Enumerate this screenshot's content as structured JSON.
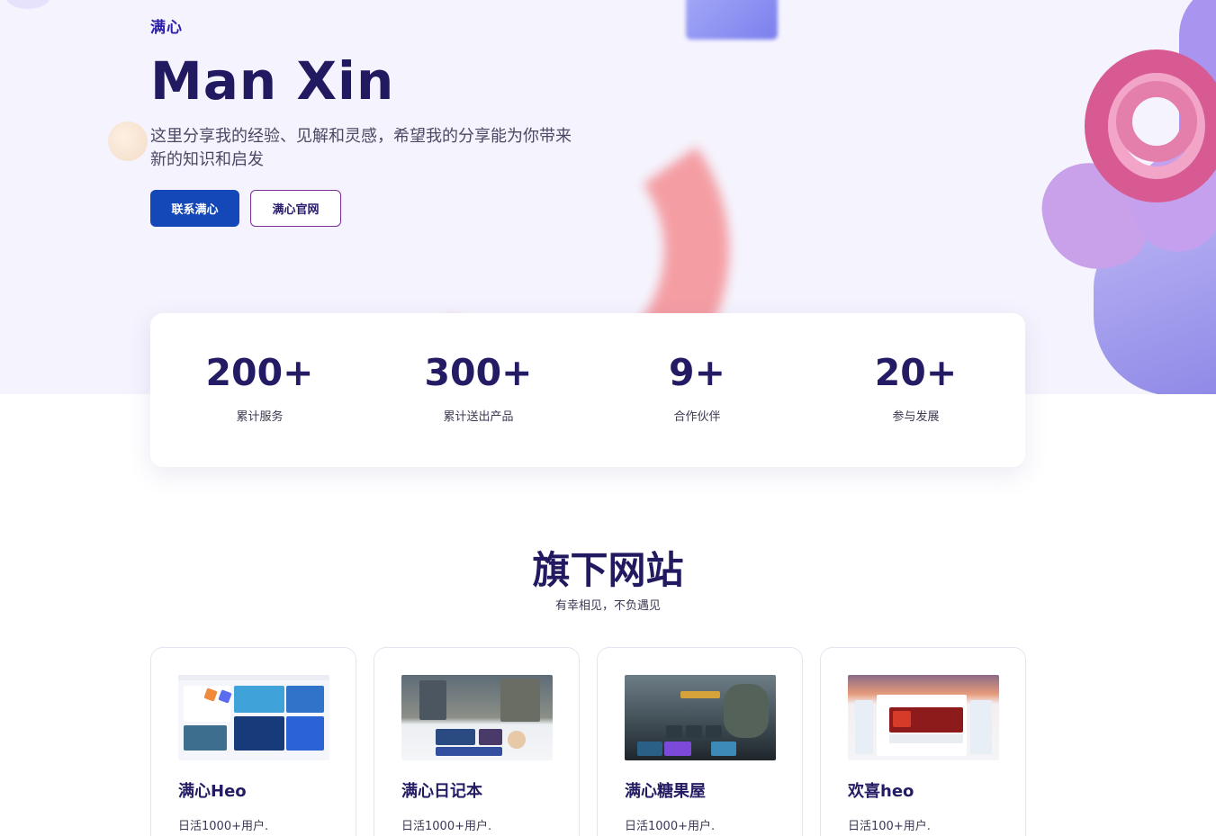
{
  "hero": {
    "eyebrow": "满心",
    "title": "Man Xin",
    "description": "这里分享我的经验、见解和灵感，希望我的分享能为你带来新的知识和启发",
    "buttons": {
      "primary": "联系满心",
      "secondary": "满心官网"
    }
  },
  "stats": [
    {
      "value": "200+",
      "label": "累计服务"
    },
    {
      "value": "300+",
      "label": "累计送出产品"
    },
    {
      "value": "9+",
      "label": "合作伙伴"
    },
    {
      "value": "20+",
      "label": "参与发展"
    }
  ],
  "section": {
    "title": "旗下网站",
    "subtitle": "有幸相见，不负遇见"
  },
  "sites": [
    {
      "title": "满心Heo",
      "desc": "日活1000+用户."
    },
    {
      "title": "满心日记本",
      "desc": "日活1000+用户."
    },
    {
      "title": "满心糖果屋",
      "desc": "日活1000+用户."
    },
    {
      "title": "欢喜heo",
      "desc": "日活100+用户."
    }
  ],
  "colors": {
    "primary_button": "#1447b8",
    "heading": "#211a60",
    "hero_background": "#f5f3fd"
  }
}
